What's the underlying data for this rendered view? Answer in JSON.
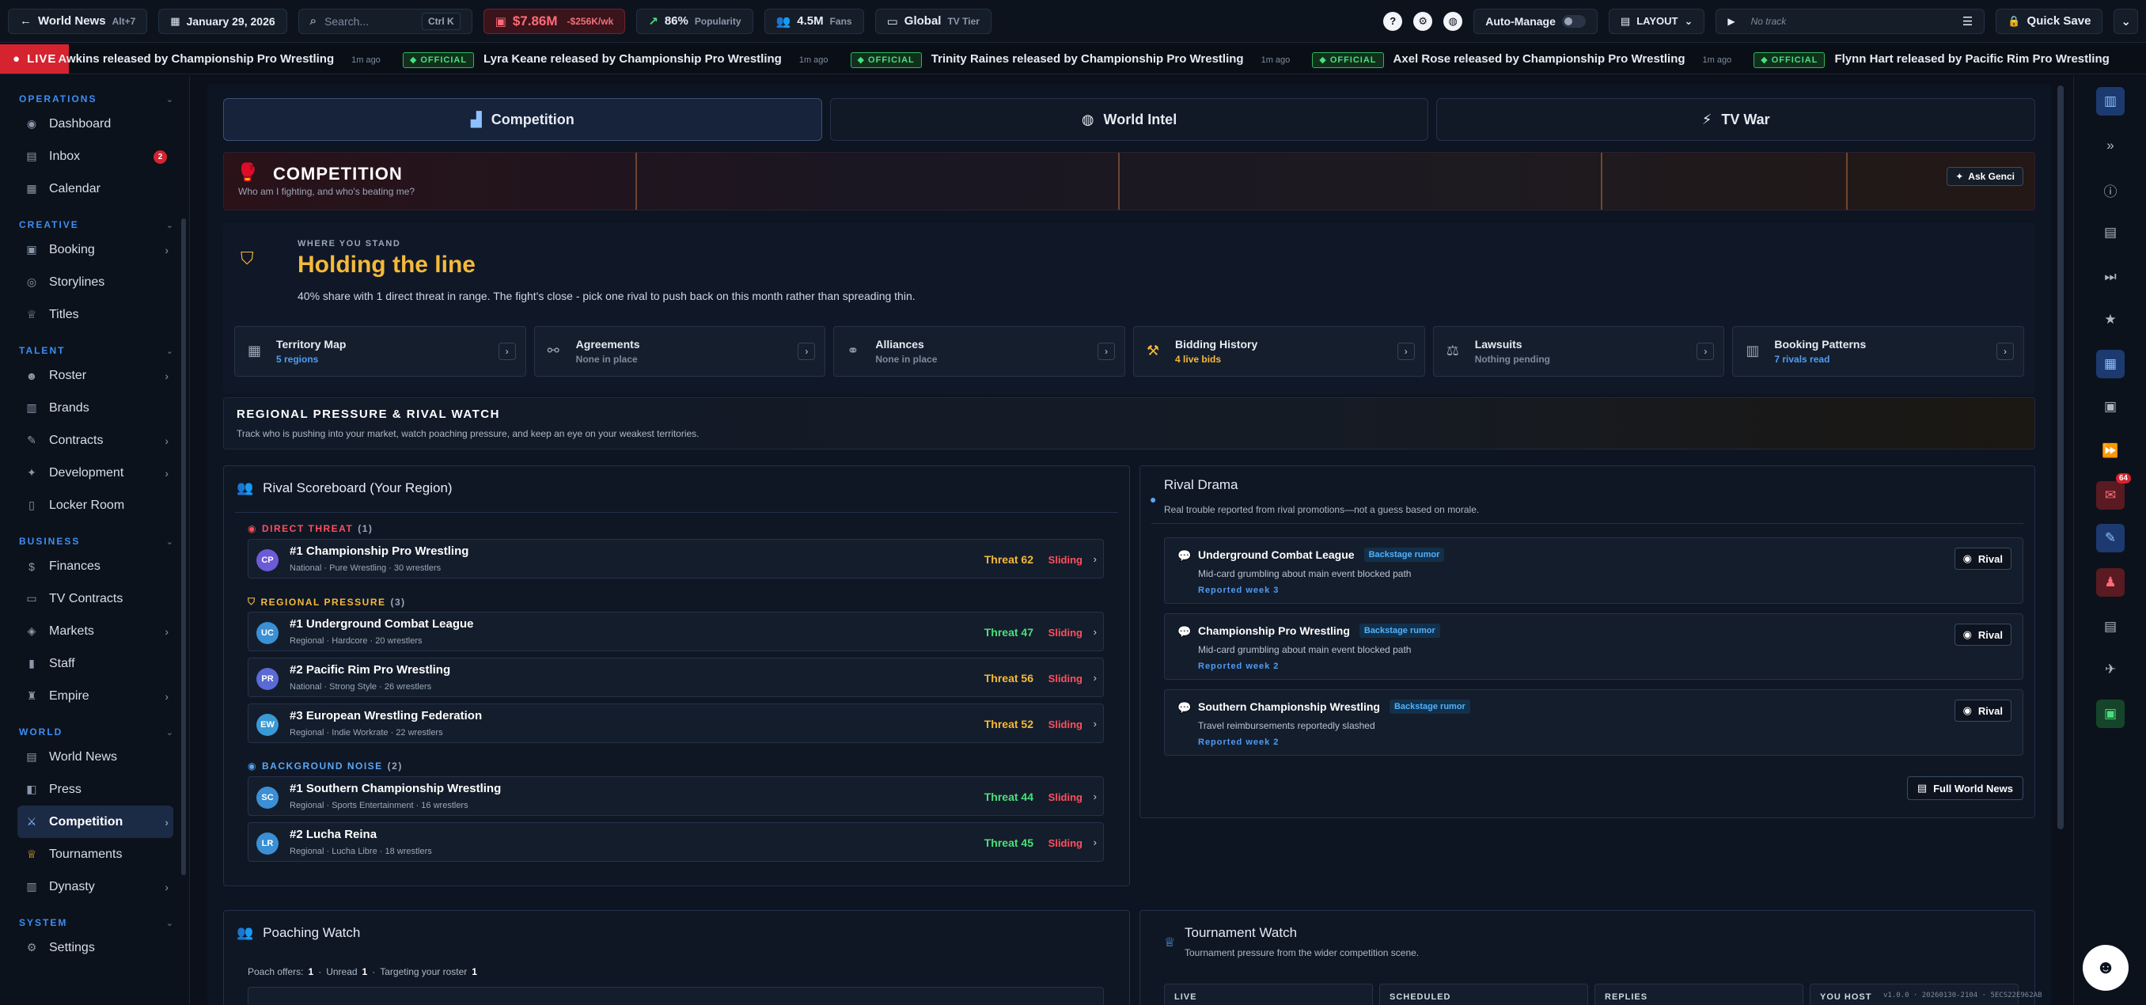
{
  "topbar": {
    "world_news": "World News",
    "world_news_kbd": "Alt+7",
    "date": "January 29, 2026",
    "search_placeholder": "Search...",
    "search_kbd": "Ctrl K",
    "money": "$7.86M",
    "money_delta": "-$256K/wk",
    "popularity_value": "86%",
    "popularity_label": "Popularity",
    "fans_value": "4.5M",
    "fans_label": "Fans",
    "tier_value": "Global",
    "tier_label": "TV Tier",
    "auto_manage": "Auto-Manage",
    "layout": "LAYOUT",
    "track": "No track",
    "quick_save": "Quick Save"
  },
  "ticker": {
    "live": "LIVE",
    "official_label": "OFFICIAL",
    "items": [
      {
        "text": "Awkins released by Championship Pro Wrestling",
        "ago": "1m ago",
        "official": false
      },
      {
        "text": "Lyra Keane released by Championship Pro Wrestling",
        "ago": "1m ago",
        "official": true
      },
      {
        "text": "Trinity Raines released by Championship Pro Wrestling",
        "ago": "1m ago",
        "official": true
      },
      {
        "text": "Axel Rose released by Championship Pro Wrestling",
        "ago": "1m ago",
        "official": true
      },
      {
        "text": "Flynn Hart released by Pacific Rim Pro Wrestling",
        "ago": "1m ago",
        "official": true
      }
    ]
  },
  "sidebar": {
    "operations": "OPERATIONS",
    "dashboard": "Dashboard",
    "inbox": "Inbox",
    "inbox_badge": "2",
    "calendar": "Calendar",
    "creative": "CREATIVE",
    "booking": "Booking",
    "storylines": "Storylines",
    "titles": "Titles",
    "talent": "TALENT",
    "roster": "Roster",
    "brands": "Brands",
    "contracts": "Contracts",
    "development": "Development",
    "locker_room": "Locker Room",
    "business": "BUSINESS",
    "finances": "Finances",
    "tv_contracts": "TV Contracts",
    "markets": "Markets",
    "staff": "Staff",
    "empire": "Empire",
    "world": "WORLD",
    "world_news": "World News",
    "press": "Press",
    "competition": "Competition",
    "tournaments": "Tournaments",
    "dynasty": "Dynasty",
    "system": "SYSTEM",
    "settings": "Settings"
  },
  "tabs": {
    "competition": "Competition",
    "world_intel": "World Intel",
    "tv_war": "TV War"
  },
  "hero": {
    "title": "COMPETITION",
    "subtitle": "Who am I fighting, and who's beating me?",
    "ask": "Ask Genci"
  },
  "standing": {
    "eyebrow": "WHERE YOU STAND",
    "headline": "Holding the line",
    "description": "40% share with 1 direct threat in range. The fight's close - pick one rival to push back on this month rather than spreading thin."
  },
  "cards": [
    {
      "title": "Territory Map",
      "sub": "5 regions",
      "color": "#4f9cf5"
    },
    {
      "title": "Agreements",
      "sub": "None in place",
      "color": "#7e8a9c"
    },
    {
      "title": "Alliances",
      "sub": "None in place",
      "color": "#7e8a9c"
    },
    {
      "title": "Bidding History",
      "sub": "4 live bids",
      "color": "#f5b93a"
    },
    {
      "title": "Lawsuits",
      "sub": "Nothing pending",
      "color": "#7e8a9c"
    },
    {
      "title": "Booking Patterns",
      "sub": "7 rivals read",
      "color": "#4f9cf5"
    }
  ],
  "regional": {
    "title": "REGIONAL PRESSURE & RIVAL WATCH",
    "desc": "Track who is pushing into your market, watch poaching pressure, and keep an eye on your weakest territories."
  },
  "scoreboard": {
    "title": "Rival Scoreboard (Your Region)",
    "direct_label": "DIRECT THREAT",
    "direct_count": "(1)",
    "regional_label": "REGIONAL PRESSURE",
    "regional_count": "(3)",
    "noise_label": "BACKGROUND NOISE",
    "noise_count": "(2)",
    "trend": "Sliding",
    "rows": [
      {
        "initials": "CP",
        "name": "#1 Championship Pro Wrestling",
        "meta": "National · Pure Wrestling · 30 wrestlers",
        "threat": "Threat 62",
        "color": "#f5b93a",
        "avatar": "#6b5bd6"
      },
      {
        "initials": "UC",
        "name": "#1 Underground Combat League",
        "meta": "Regional · Hardcore · 20 wrestlers",
        "threat": "Threat 47",
        "color": "#49e07b",
        "avatar": "#3a8fd5"
      },
      {
        "initials": "PR",
        "name": "#2 Pacific Rim Pro Wrestling",
        "meta": "National · Strong Style · 26 wrestlers",
        "threat": "Threat 56",
        "color": "#f5b93a",
        "avatar": "#5a6ad6"
      },
      {
        "initials": "EW",
        "name": "#3 European Wrestling Federation",
        "meta": "Regional · Indie Workrate · 22 wrestlers",
        "threat": "Threat 52",
        "color": "#f5b93a",
        "avatar": "#3a9ad5"
      },
      {
        "initials": "SC",
        "name": "#1 Southern Championship Wrestling",
        "meta": "Regional · Sports Entertainment · 16 wrestlers",
        "threat": "Threat 44",
        "color": "#49e07b",
        "avatar": "#3a8fd5"
      },
      {
        "initials": "LR",
        "name": "#2 Lucha Reina",
        "meta": "Regional · Lucha Libre · 18 wrestlers",
        "threat": "Threat 45",
        "color": "#49e07b",
        "avatar": "#3a8fd5"
      }
    ]
  },
  "drama": {
    "title": "Rival Drama",
    "desc": "Real trouble reported from rival promotions—not a guess based on morale.",
    "tag": "Backstage rumor",
    "rival_btn": "Rival",
    "full_btn": "Full World News",
    "items": [
      {
        "name": "Underground Combat League",
        "detail": "Mid-card grumbling about main event blocked path",
        "week": "Reported week 3"
      },
      {
        "name": "Championship Pro Wrestling",
        "detail": "Mid-card grumbling about main event blocked path",
        "week": "Reported week 2"
      },
      {
        "name": "Southern Championship Wrestling",
        "detail": "Travel reimbursements reportedly slashed",
        "week": "Reported week 2"
      }
    ]
  },
  "poaching": {
    "title": "Poaching Watch",
    "offers_label": "Poach offers:",
    "offers": "1",
    "unread_label": "Unread",
    "unread": "1",
    "targeting_label": "Targeting your roster",
    "targeting": "1"
  },
  "tournament": {
    "title": "Tournament Watch",
    "desc": "Tournament pressure from the wider competition scene.",
    "col1": "LIVE",
    "col2": "SCHEDULED",
    "col3": "REPLIES",
    "col4": "YOU HOST"
  },
  "rail": {
    "mail_badge": "64"
  },
  "version": "v1.0.0 · 20260130-2104 · 5ECS22E962AB"
}
